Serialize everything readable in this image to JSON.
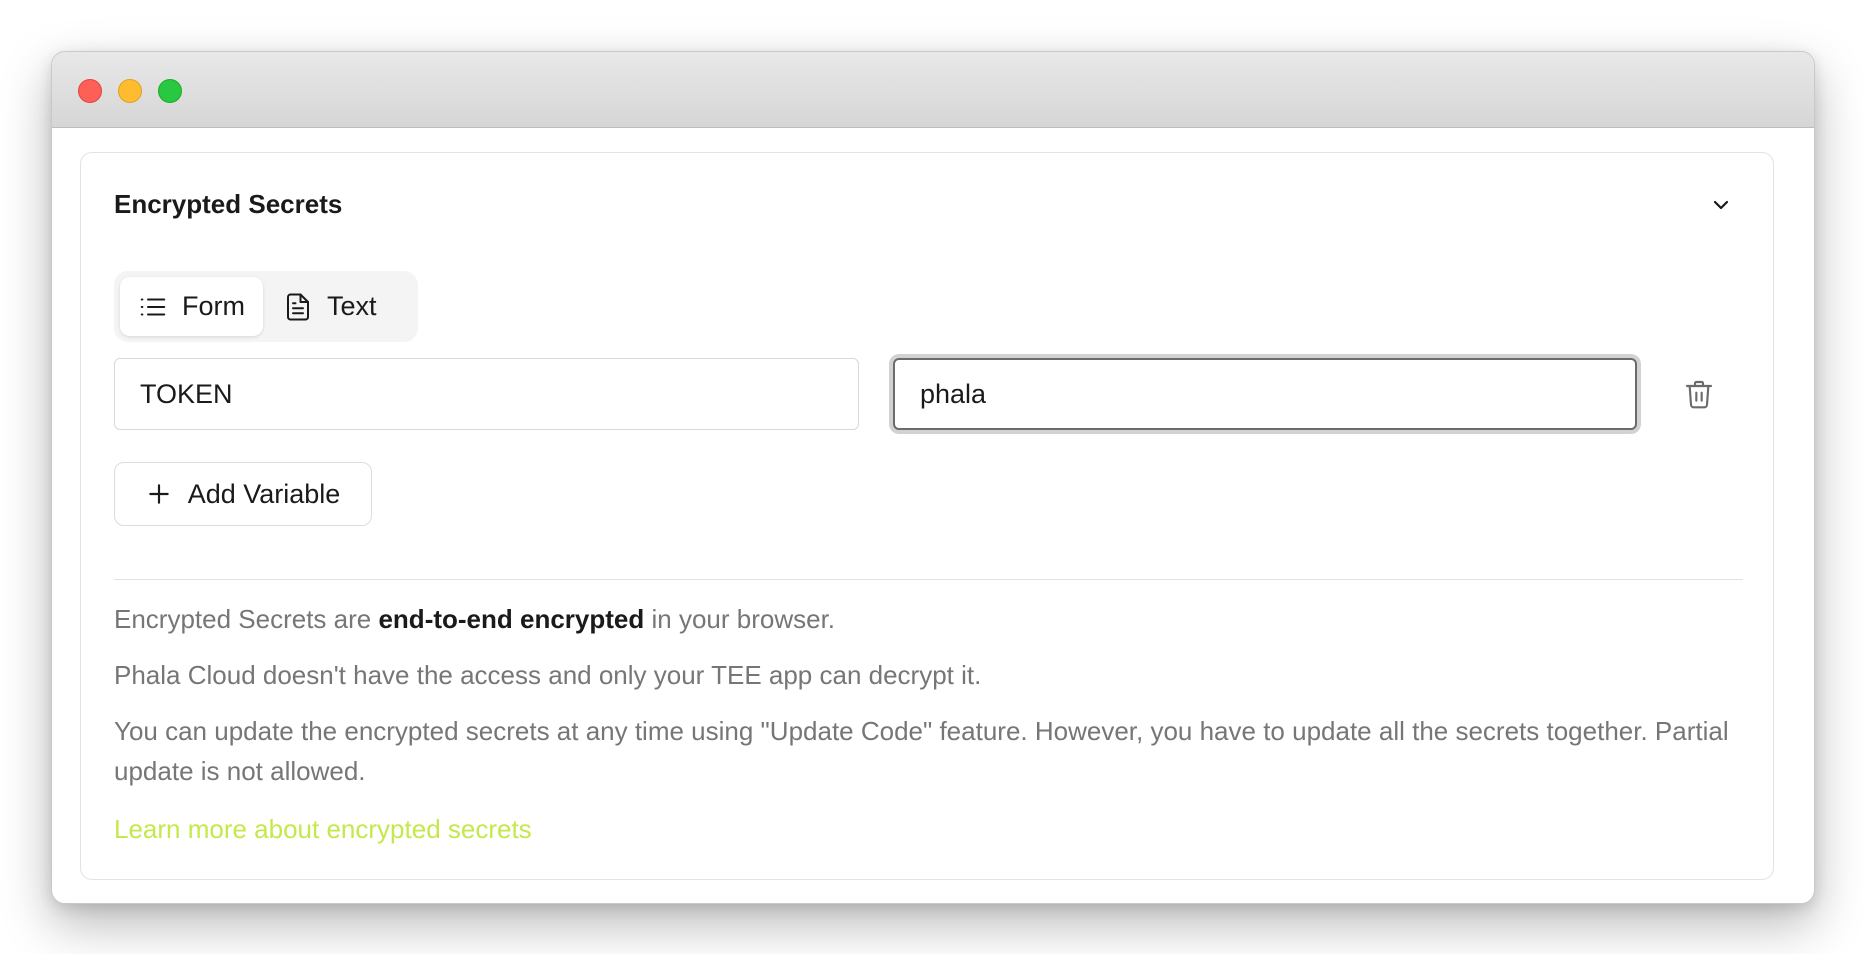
{
  "section": {
    "title": "Encrypted Secrets"
  },
  "mode_toggle": {
    "form_label": "Form",
    "text_label": "Text",
    "selected": "Form"
  },
  "variables": [
    {
      "key": "TOKEN",
      "value": "phala"
    }
  ],
  "actions": {
    "add_variable_label": "Add Variable"
  },
  "info": {
    "p1_before": "Encrypted Secrets are ",
    "p1_bold": "end-to-end encrypted",
    "p1_after": " in your browser.",
    "p2": "Phala Cloud doesn't have the access and only your TEE app can decrypt it.",
    "p3": "You can update the encrypted secrets at any time using \"Update Code\" feature. However, you have to update all the secrets together. Partial update is not allowed.",
    "learn_more": "Learn more about encrypted secrets"
  },
  "colors": {
    "link": "#c5e84a",
    "muted_text": "#767676",
    "primary_text": "#1a1a1a"
  },
  "icons": {
    "form": "list-icon",
    "text": "file-text-icon",
    "delete": "trash-icon",
    "add": "plus-icon",
    "collapse": "chevron-down-icon"
  }
}
